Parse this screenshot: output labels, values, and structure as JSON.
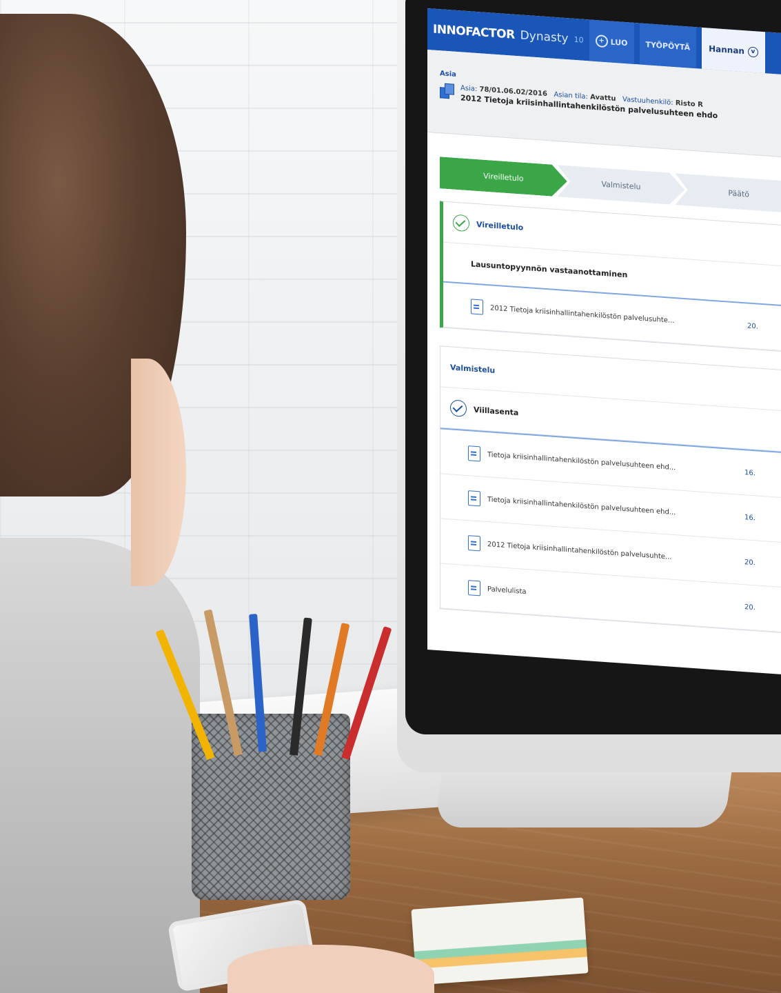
{
  "app": {
    "brand": "INNOFACTOR",
    "product": "Dynasty",
    "version": "10",
    "nav": {
      "create_label": "LUO",
      "desktop_label": "TYÖPÖYTÄ",
      "user_label": "Hannan"
    }
  },
  "case": {
    "section_label": "Asia",
    "id_label": "Asia:",
    "id_value": "78/01.06.02/2016",
    "status_label": "Asian tila:",
    "status_value": "Avattu",
    "owner_label": "Vastuuhenkilö:",
    "owner_value": "Risto R",
    "title": "2012 Tietoja kriisinhallintahenkilöstön palvelusuhteen ehdo"
  },
  "stepper": [
    "Vireilletulo",
    "Valmistelu",
    "Päätö"
  ],
  "panels": {
    "vireilletulo": {
      "title": "Vireilletulo",
      "task": "Lausuntopyynnön vastaanottaminen",
      "docs": [
        {
          "name": "2012 Tietoja kriisinhallintahenkilöstön palvelusuhte...",
          "date": "20."
        }
      ]
    },
    "valmistelu": {
      "title": "Valmistelu",
      "subtitle": "Viillasenta",
      "docs": [
        {
          "name": "Tietoja kriisinhallintahenkilöstön palvelusuhteen ehd...",
          "date": "16."
        },
        {
          "name": "Tietoja kriisinhallintahenkilöstön palvelusuhteen ehd...",
          "date": "16."
        },
        {
          "name": "2012 Tietoja kriisinhallintahenkilöstön palvelusuhte...",
          "date": "20."
        },
        {
          "name": "Palvelulista",
          "date": "20."
        }
      ]
    }
  },
  "colors": {
    "header_blue": "#1a56b8",
    "active_step_green": "#3aa648",
    "link_blue": "#1b4ea6"
  },
  "icons": [
    "add-circle-icon",
    "chevron-down-icon",
    "case-folder-icon",
    "check-circle-icon",
    "document-icon"
  ]
}
